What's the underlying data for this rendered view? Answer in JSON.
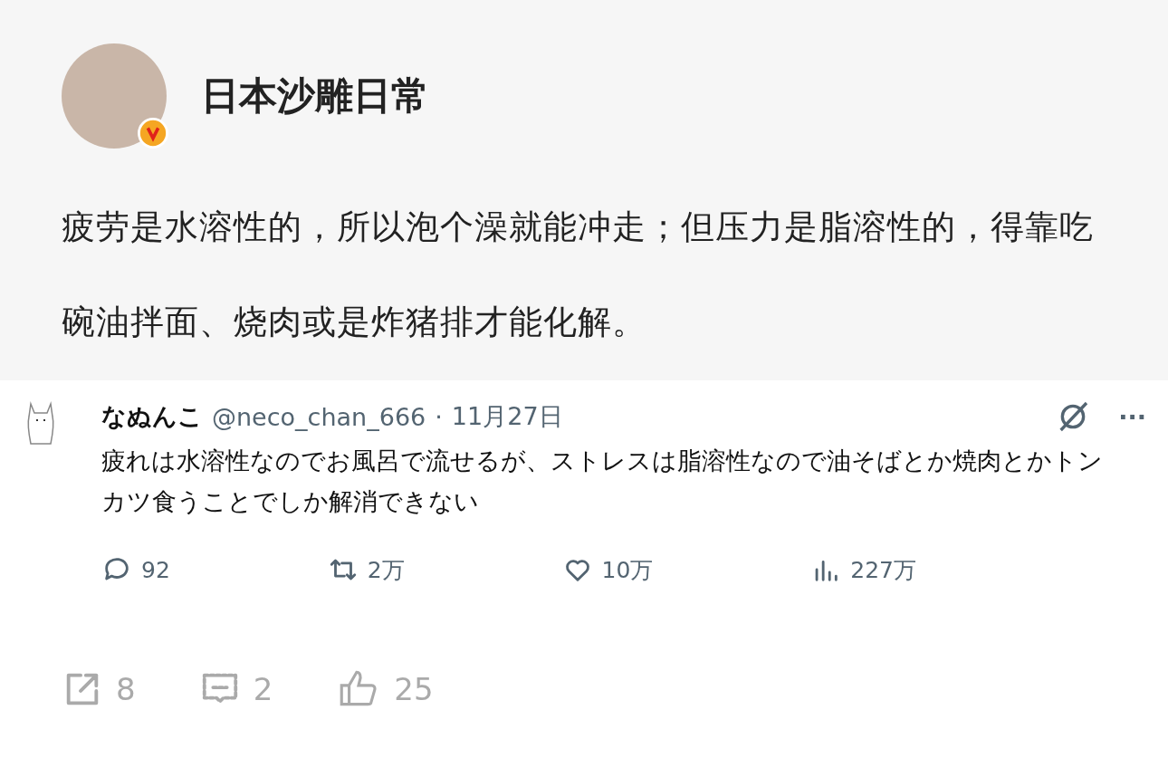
{
  "post": {
    "author": "日本沙雕日常",
    "verified": true,
    "text": "疲劳是水溶性的，所以泡个澡就能冲走；但压力是脂溶性的，得靠吃碗油拌面、烧肉或是炸猪排才能化解。"
  },
  "quoted_tweet": {
    "name": "なぬんこ",
    "handle": "@neco_chan_666",
    "separator": "·",
    "date": "11月27日",
    "text": "疲れは水溶性なのでお風呂で流せるが、ストレスは脂溶性なので油そばとか焼肉とかトンカツ食うことでしか解消できない",
    "more": "···",
    "actions": [
      {
        "kind": "reply",
        "count": "92"
      },
      {
        "kind": "retweet",
        "count": "2万"
      },
      {
        "kind": "like",
        "count": "10万"
      },
      {
        "kind": "views",
        "count": "227万"
      }
    ]
  },
  "stats": [
    {
      "kind": "share",
      "count": "8"
    },
    {
      "kind": "comment",
      "count": "2"
    },
    {
      "kind": "like",
      "count": "25"
    }
  ]
}
